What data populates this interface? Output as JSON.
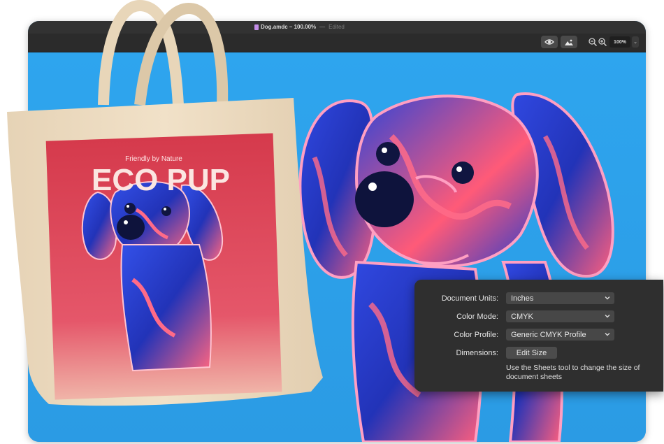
{
  "window": {
    "title": "Dog.amdc – 100.00%",
    "title_sep": "—",
    "status": "Edited"
  },
  "toolbar": {
    "icons": [
      "eye-icon",
      "image-icon",
      "zoom-out-icon",
      "zoom-in-icon"
    ],
    "zoom_value": "100%"
  },
  "tote": {
    "subtitle": "Friendly by Nature",
    "title": "ECO PUP"
  },
  "settings": {
    "document_units_label": "Document Units:",
    "document_units_value": "Inches",
    "color_mode_label": "Color Mode:",
    "color_mode_value": "CMYK",
    "color_profile_label": "Color Profile:",
    "color_profile_value": "Generic CMYK Profile",
    "dimensions_label": "Dimensions:",
    "edit_size_label": "Edit Size",
    "hint": "Use the Sheets tool to change the size of document sheets"
  },
  "colors": {
    "canvas_blue": "#2f9fe6",
    "poster_red": "#d83a4b",
    "dog_blue": "#2a3fd0",
    "dog_pink": "#ff6f8a",
    "tote_canvas": "#ecd9bd",
    "panel_bg": "#2f2f2f"
  }
}
